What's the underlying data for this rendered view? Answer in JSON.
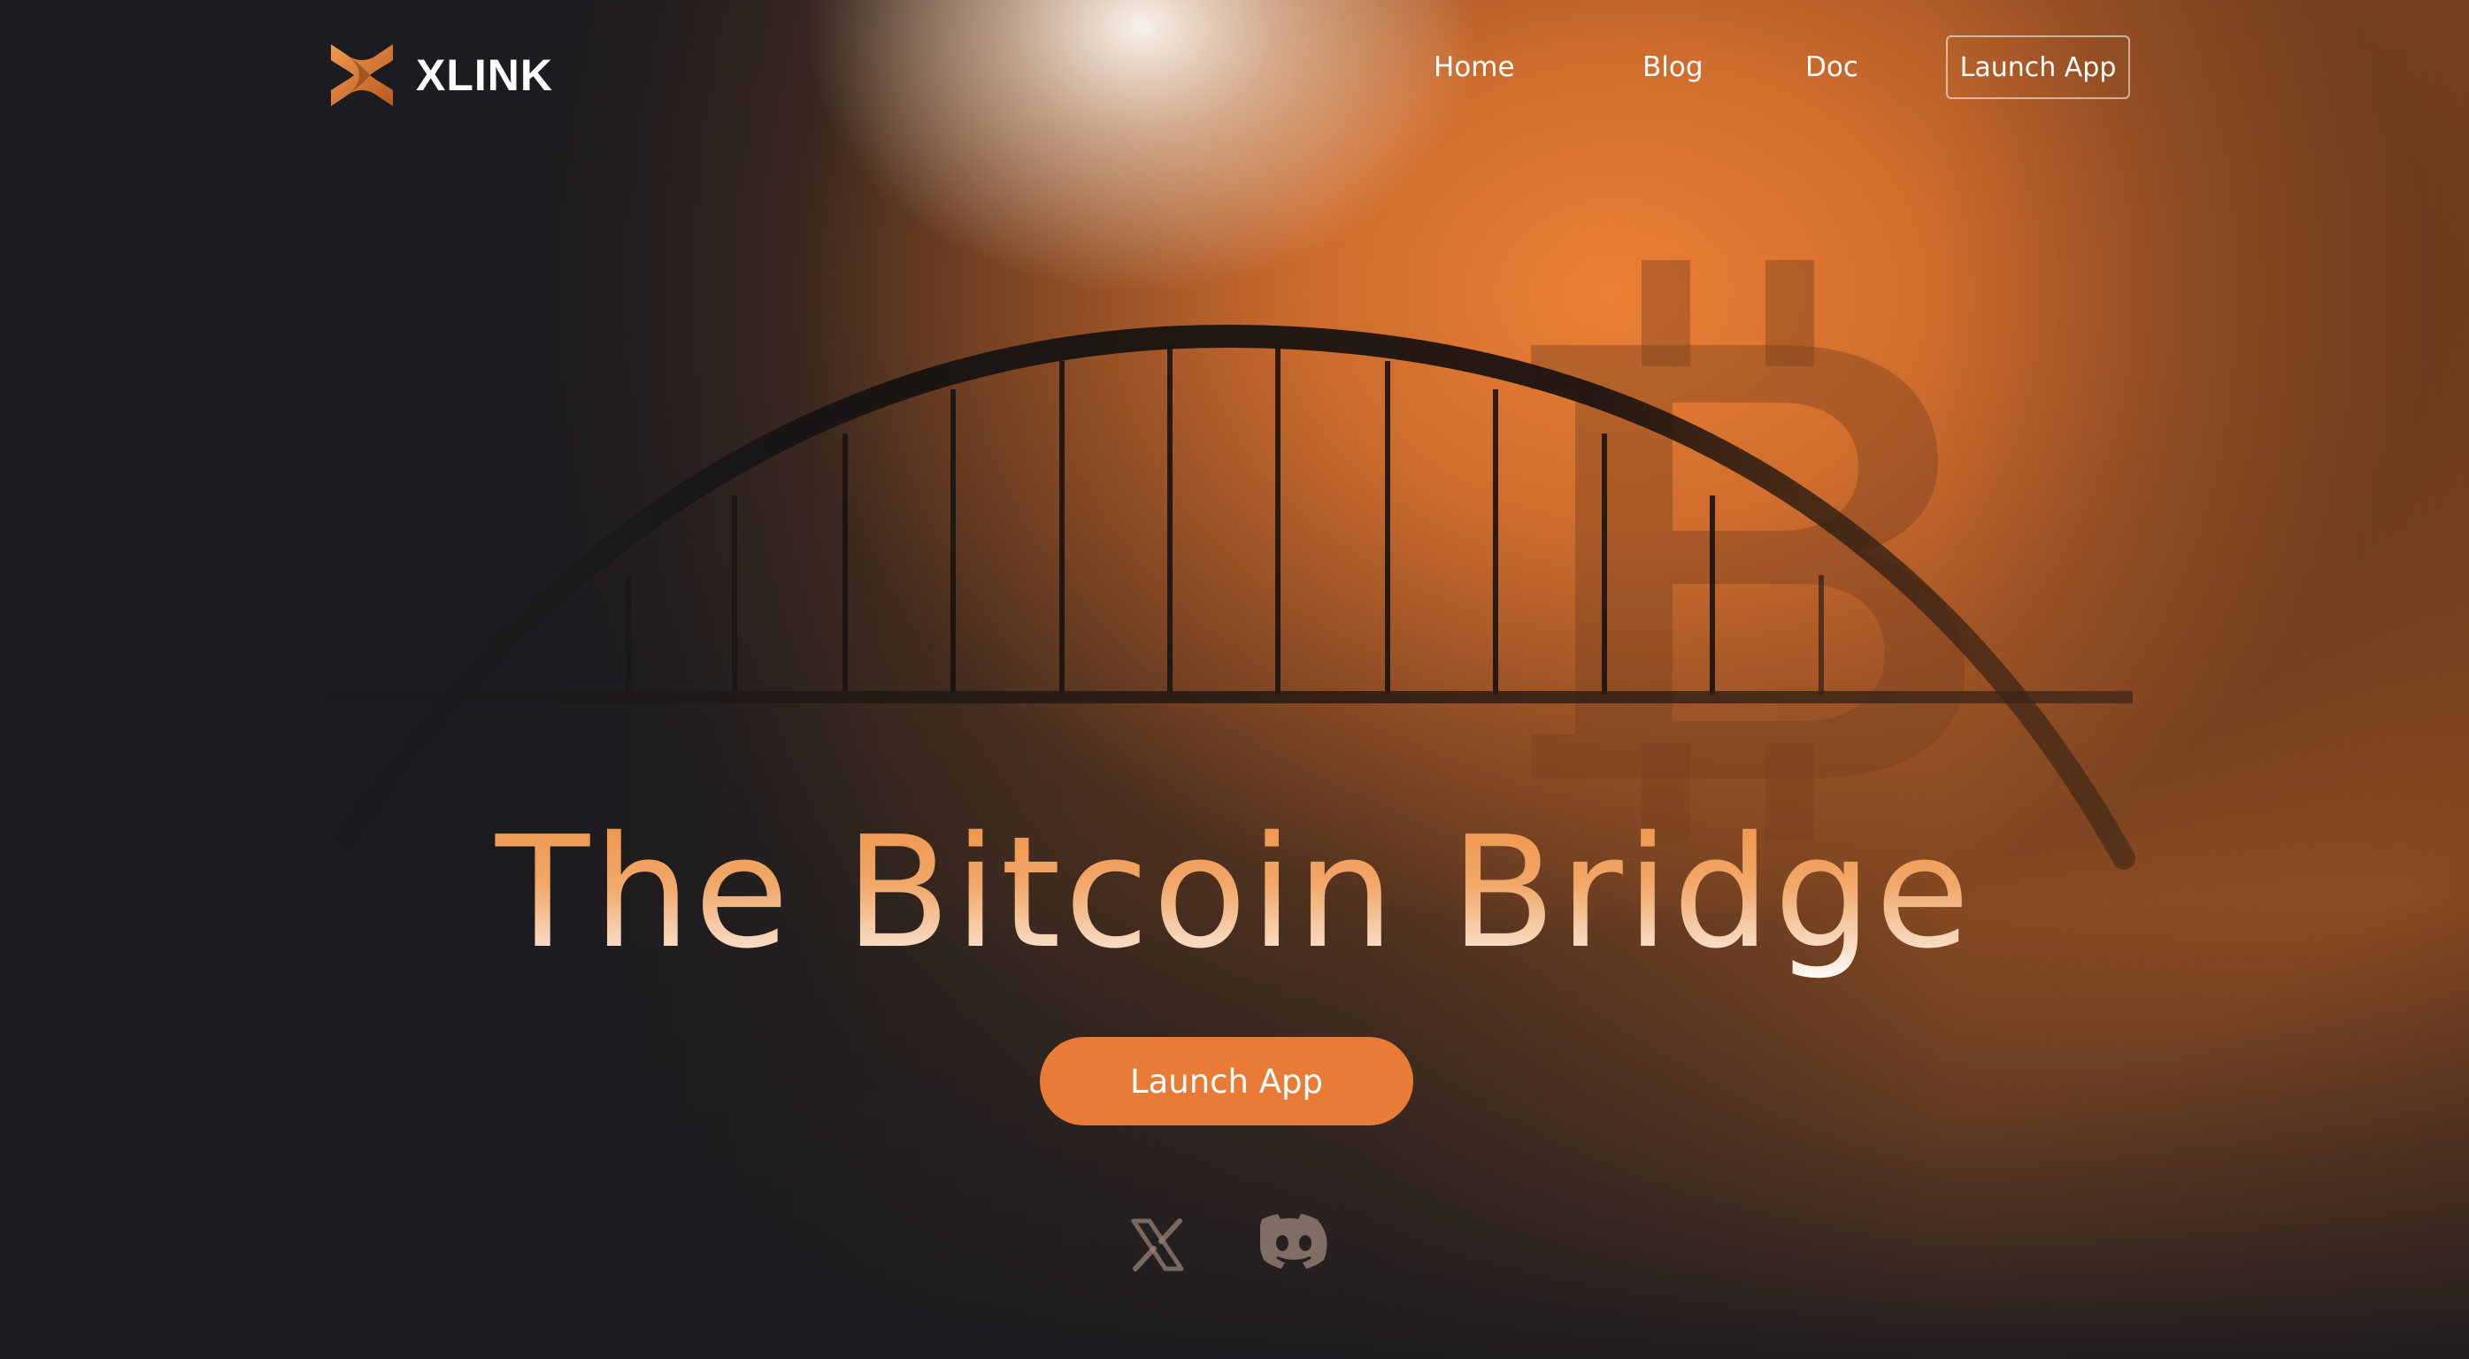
{
  "brand": {
    "name": "XLINK",
    "accent_color": "#e87b35",
    "logo_icon": "xlink-logo-icon"
  },
  "nav": {
    "items": [
      {
        "label": "Home"
      },
      {
        "label": "Blog"
      },
      {
        "label": "Doc"
      }
    ],
    "launch_label": "Launch App"
  },
  "hero": {
    "title": "The Bitcoin Bridge",
    "cta_label": "Launch App",
    "background_icons": [
      "bitcoin-icon",
      "bridge-illustration"
    ]
  },
  "social": {
    "links": [
      {
        "icon": "x-icon"
      },
      {
        "icon": "discord-icon"
      }
    ]
  }
}
